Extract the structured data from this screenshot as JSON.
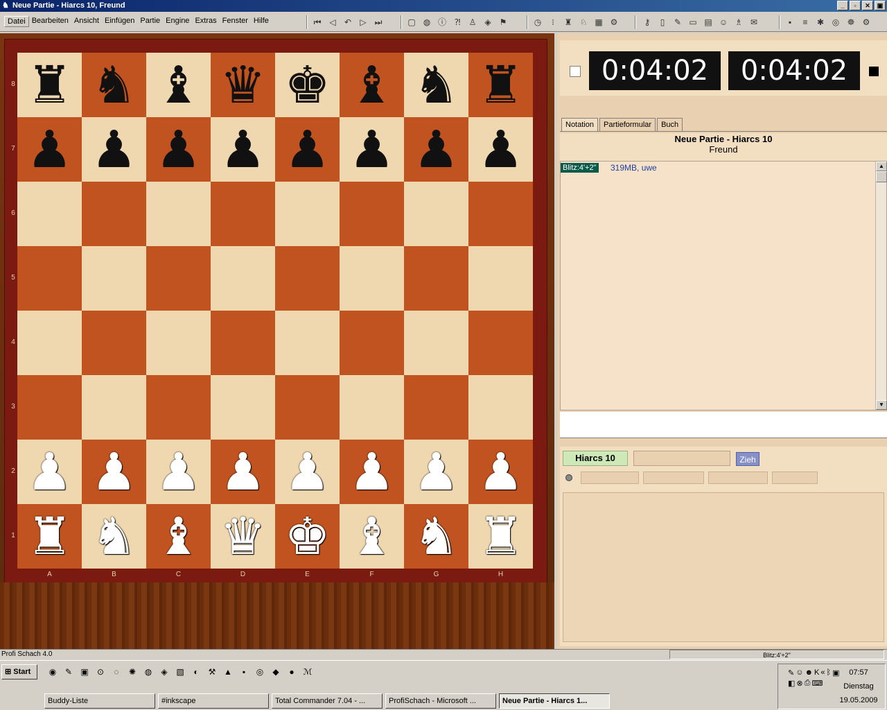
{
  "window": {
    "title": "Neue Partie - Hiarcs 10, Freund",
    "buttons": [
      "_",
      "▫",
      "✕",
      "▣"
    ]
  },
  "menu": [
    "Datei",
    "Bearbeiten",
    "Ansicht",
    "Einfügen",
    "Partie",
    "Engine",
    "Extras",
    "Fenster",
    "Hilfe"
  ],
  "toolbar_icons": [
    "first-move-icon",
    "prev-move-icon",
    "take-back-icon",
    "next-move-icon",
    "last-move-icon",
    "new-game-icon",
    "globe-icon",
    "info-icon",
    "analysis-icon",
    "figure-icon",
    "shield-icon",
    "flag-icon",
    "clock-icon",
    "eye-icon",
    "pieces-icon",
    "knight-icon",
    "board-icon",
    "engine-icon",
    "key-icon",
    "book-icon",
    "write-icon",
    "window-icon",
    "grid-icon",
    "user-icon",
    "person-icon",
    "chat-icon",
    "save-icon",
    "tools-icon",
    "settings-icon",
    "database-icon",
    "gear-icon",
    "help-icon"
  ],
  "board": {
    "ranks": [
      "8",
      "7",
      "6",
      "5",
      "4",
      "3",
      "2",
      "1"
    ],
    "files": [
      "A",
      "B",
      "C",
      "D",
      "E",
      "F",
      "G",
      "H"
    ],
    "position": [
      [
        "r",
        "n",
        "b",
        "q",
        "k",
        "b",
        "n",
        "r"
      ],
      [
        "p",
        "p",
        "p",
        "p",
        "p",
        "p",
        "p",
        "p"
      ],
      [
        "",
        "",
        "",
        "",
        "",
        "",
        "",
        ""
      ],
      [
        "",
        "",
        "",
        "",
        "",
        "",
        "",
        ""
      ],
      [
        "",
        "",
        "",
        "",
        "",
        "",
        "",
        ""
      ],
      [
        "",
        "",
        "",
        "",
        "",
        "",
        "",
        ""
      ],
      [
        "P",
        "P",
        "P",
        "P",
        "P",
        "P",
        "P",
        "P"
      ],
      [
        "R",
        "N",
        "B",
        "Q",
        "K",
        "B",
        "N",
        "R"
      ]
    ]
  },
  "clocks": {
    "white": "0:04:02",
    "black": "0:04:02"
  },
  "tabs": [
    "Notation",
    "Partieformular",
    "Buch"
  ],
  "notation": {
    "title": "Neue Partie - Hiarcs 10",
    "subtitle": "Freund",
    "time_control": "Blitz:4'+2\"",
    "info": "319MB, uwe"
  },
  "engine": {
    "name": "Hiarcs 10",
    "move_button": "Zieh"
  },
  "status": {
    "left": "Profi Schach 4.0",
    "right": "Blitz:4'+2\""
  },
  "taskbar": {
    "start": "Start",
    "tasks": [
      "Buddy-Liste",
      "#inkscape",
      "Total Commander 7.04 - ...",
      "ProfiSchach - Microsoft ...",
      "Neue Partie - Hiarcs 1..."
    ],
    "active_task": 4,
    "time": "07:57",
    "day": "Dienstag",
    "date": "19.05.2009"
  }
}
